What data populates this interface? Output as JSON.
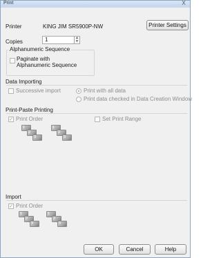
{
  "window": {
    "title": "Print",
    "close_glyph": "X"
  },
  "printer": {
    "label": "Printer",
    "name": "KING JIM SR5900P-NW",
    "settings_button": "Printer Settings"
  },
  "copies": {
    "label": "Copies",
    "value": "1",
    "up": "▲",
    "down": "▼"
  },
  "alpha_sequence": {
    "group_title": "Alphanumeric Sequence",
    "paginate_label_line1": "Paginate with",
    "paginate_label_line2": "Alphanumeric Sequence",
    "paginate_checked": false
  },
  "data_importing": {
    "title": "Data Importing",
    "successive_import": "Successive import",
    "successive_checked": false,
    "print_all": "Print with all data",
    "print_checked": "Print data checked in Data Creation Window",
    "selected": "print_all"
  },
  "print_paste": {
    "title": "Print-Paste Printing",
    "print_order": "Print Order",
    "print_order_checked": true,
    "set_print_range": "Set Print Range",
    "set_print_range_checked": false,
    "stack_a": [
      "1",
      "2",
      "3"
    ],
    "stack_b": [
      "1",
      "2",
      "3"
    ]
  },
  "import": {
    "title": "Import",
    "print_order": "Print Order",
    "print_order_checked": true,
    "stack_a": [
      "1",
      "2",
      "3"
    ],
    "stack_b": [
      "1",
      "2",
      "3"
    ]
  },
  "footer": {
    "ok": "OK",
    "cancel": "Cancel",
    "help": "Help"
  },
  "check_glyph": "✓"
}
